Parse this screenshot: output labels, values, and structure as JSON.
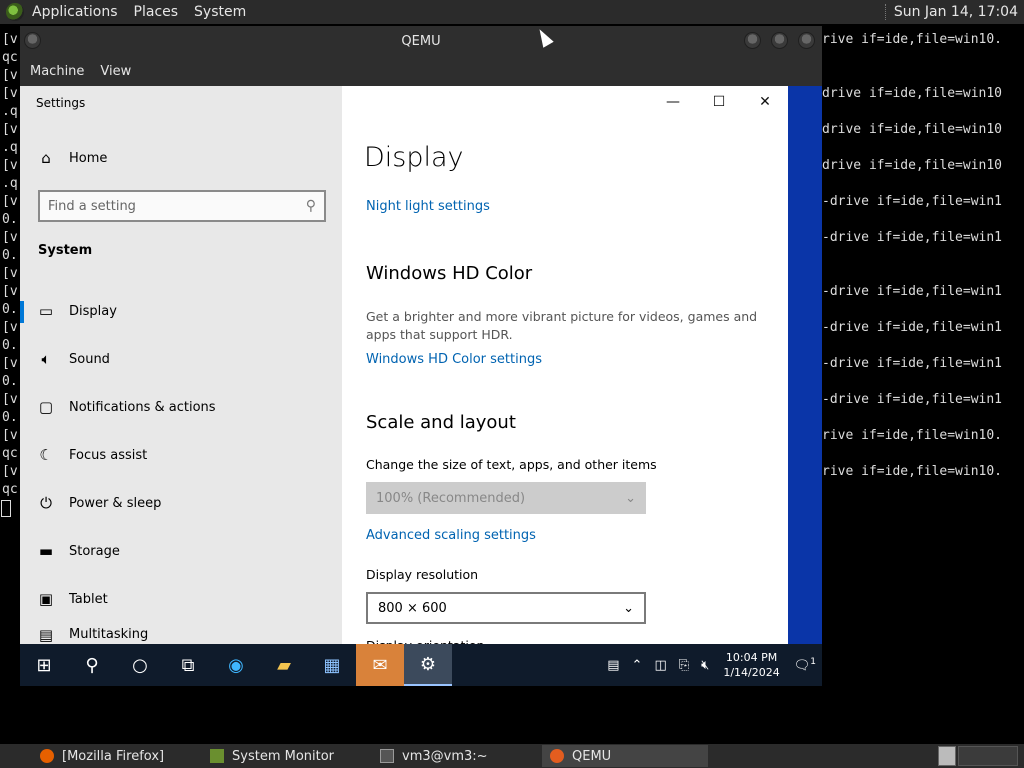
{
  "top_panel": {
    "menus": [
      "Applications",
      "Places",
      "System"
    ],
    "clock": "Sun Jan 14, 17:04"
  },
  "terminal": {
    "left_lines": [
      "[v",
      "qc",
      "[v",
      "[v",
      ".q",
      "[v",
      ".q",
      "[v",
      ".q",
      "[v",
      "0.",
      "[v",
      "0.",
      "[v",
      "[v",
      "0.",
      "[v",
      "0.",
      "[v",
      "0.",
      "[v",
      "0.",
      "[v",
      "qc",
      "[v",
      "qc"
    ],
    "right_lines": [
      "rive if=ide,file=win10.",
      "drive if=ide,file=win10",
      "drive if=ide,file=win10",
      "drive if=ide,file=win10",
      "-drive if=ide,file=win1",
      "-drive if=ide,file=win1",
      "-drive if=ide,file=win1",
      "-drive if=ide,file=win1",
      "-drive if=ide,file=win1",
      "-drive if=ide,file=win1",
      "rive if=ide,file=win10.",
      "rive if=ide,file=win10."
    ]
  },
  "qemu": {
    "title": "QEMU",
    "menus": [
      "Machine",
      "View"
    ]
  },
  "settings": {
    "app_title": "Settings",
    "home_label": "Home",
    "search_placeholder": "Find a setting",
    "section": "System",
    "nav_items": [
      "Display",
      "Sound",
      "Notifications & actions",
      "Focus assist",
      "Power & sleep",
      "Storage",
      "Tablet",
      "Multitasking"
    ],
    "page_title": "Display",
    "night_light_link": "Night light settings",
    "hd_color_heading": "Windows HD Color",
    "hd_color_desc": "Get a brighter and more vibrant picture for videos, games and apps that support HDR.",
    "hd_color_link": "Windows HD Color settings",
    "scale_heading": "Scale and layout",
    "scale_label": "Change the size of text, apps, and other items",
    "scale_value": "100% (Recommended)",
    "advanced_scaling_link": "Advanced scaling settings",
    "resolution_label": "Display resolution",
    "resolution_value": "800 × 600",
    "orientation_label": "Display orientation"
  },
  "taskbar": {
    "time": "10:04 PM",
    "date": "1/14/2024",
    "notification_count": "1"
  },
  "bottom_panel": {
    "items": [
      "[Mozilla Firefox]",
      "System Monitor",
      "vm3@vm3:~",
      "QEMU"
    ]
  },
  "colors": {
    "accent": "#0078d7",
    "link": "#0063b1",
    "desktop_blue": "#0a35a8",
    "taskbar": "#0f1b2b"
  }
}
